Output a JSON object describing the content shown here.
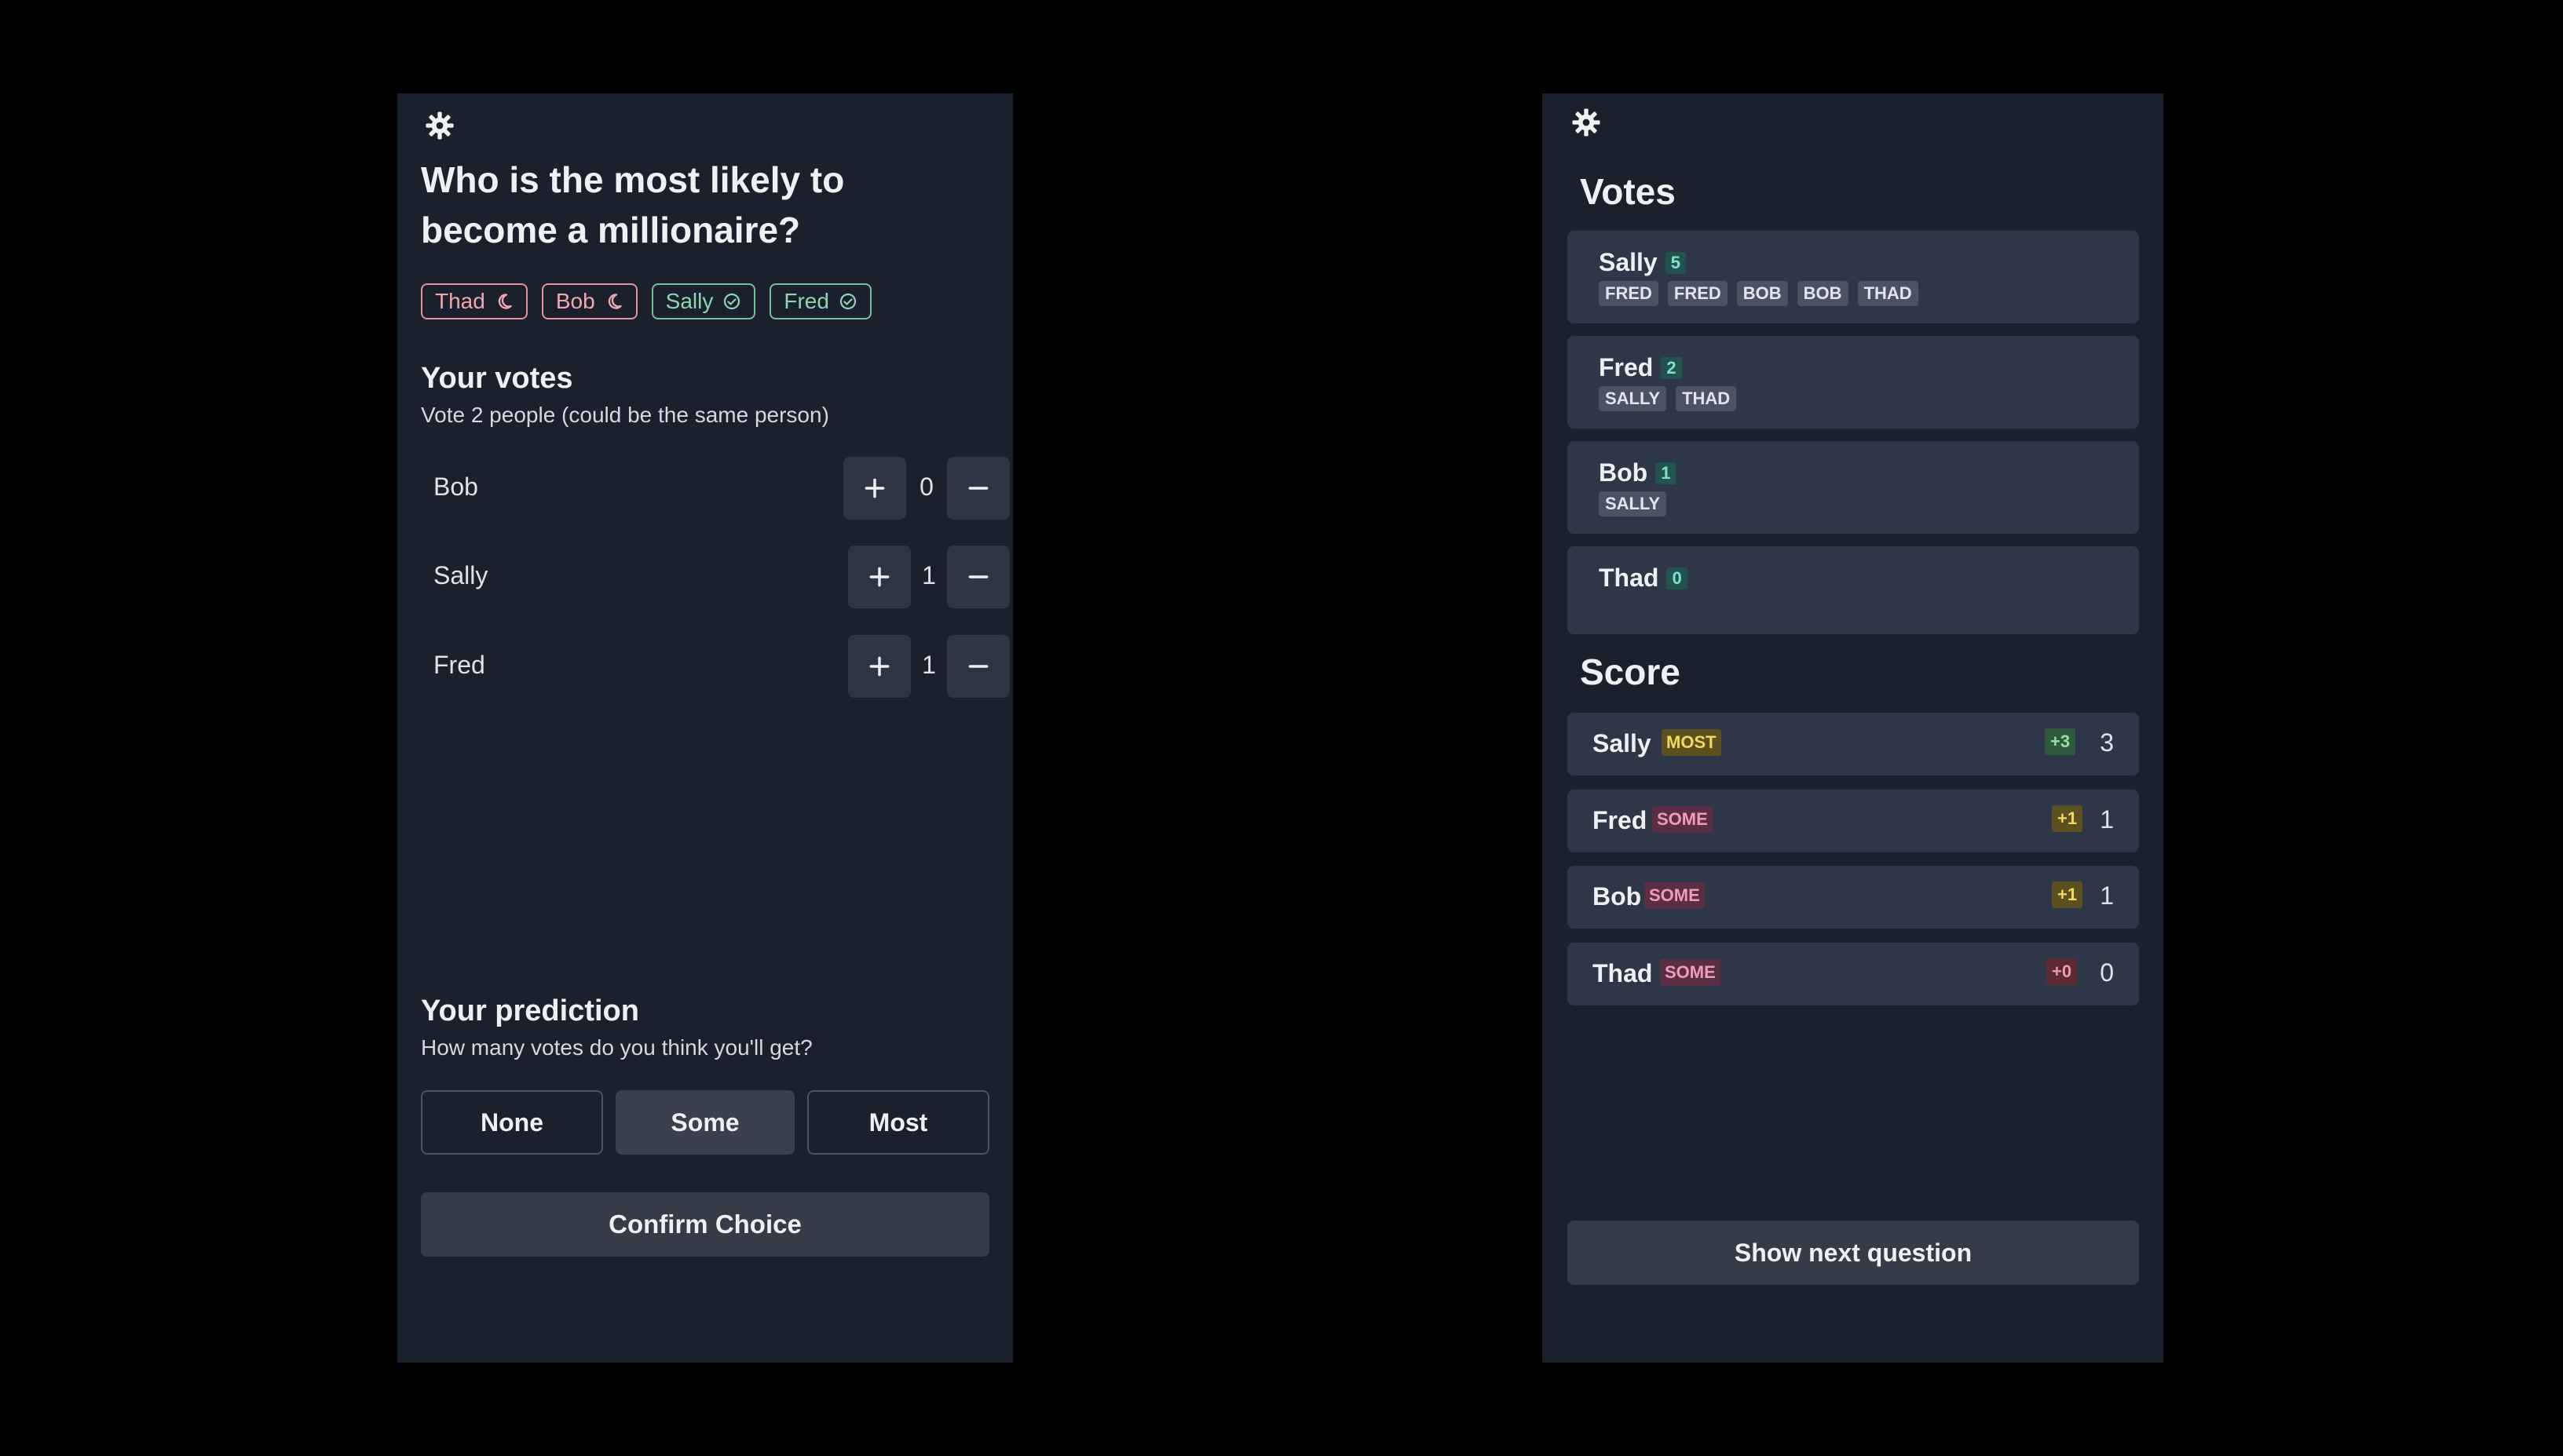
{
  "colors": {
    "background": "#000000",
    "panel": "#1a202c",
    "card": "#2d3748",
    "pending": "#e58f9b",
    "done": "#6fc39a"
  },
  "left": {
    "settings_icon": "gear-icon",
    "question": "Who is the most likely to become a millionaire?",
    "players": [
      {
        "name": "Thad",
        "status": "pending",
        "icon": "moon-icon"
      },
      {
        "name": "Bob",
        "status": "pending",
        "icon": "moon-icon"
      },
      {
        "name": "Sally",
        "status": "done",
        "icon": "check-circle-icon"
      },
      {
        "name": "Fred",
        "status": "done",
        "icon": "check-circle-icon"
      }
    ],
    "your_votes": {
      "title": "Your votes",
      "subtitle": "Vote 2 people (could be the same person)",
      "rows": [
        {
          "name": "Bob",
          "count": "0"
        },
        {
          "name": "Sally",
          "count": "1"
        },
        {
          "name": "Fred",
          "count": "1"
        }
      ]
    },
    "prediction": {
      "title": "Your prediction",
      "subtitle": "How many votes do you think you'll get?",
      "options": [
        "None",
        "Some",
        "Most"
      ],
      "selected": "Some"
    },
    "confirm_label": "Confirm Choice"
  },
  "right": {
    "settings_icon": "gear-icon",
    "votes_title": "Votes",
    "votes": [
      {
        "name": "Sally",
        "count": "5",
        "voters": [
          "FRED",
          "FRED",
          "BOB",
          "BOB",
          "THAD"
        ]
      },
      {
        "name": "Fred",
        "count": "2",
        "voters": [
          "SALLY",
          "THAD"
        ]
      },
      {
        "name": "Bob",
        "count": "1",
        "voters": [
          "SALLY"
        ]
      },
      {
        "name": "Thad",
        "count": "0",
        "voters": []
      }
    ],
    "score_title": "Score",
    "scores": [
      {
        "name": "Sally",
        "level": "MOST",
        "delta": "+3",
        "total": "3"
      },
      {
        "name": "Fred",
        "level": "SOME",
        "delta": "+1",
        "total": "1"
      },
      {
        "name": "Bob",
        "level": "SOME",
        "delta": "+1",
        "total": "1"
      },
      {
        "name": "Thad",
        "level": "SOME",
        "delta": "+0",
        "total": "0"
      }
    ],
    "next_label": "Show next question"
  }
}
